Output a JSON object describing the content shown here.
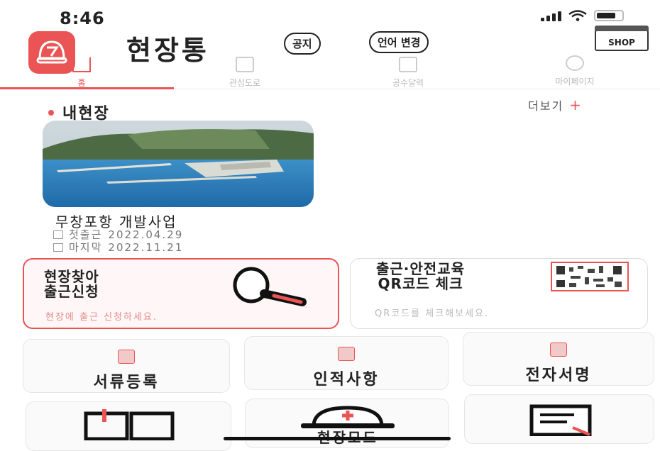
{
  "status": {
    "time": "8:46"
  },
  "header": {
    "title": "현장통",
    "notice_label": "공지",
    "lang_label": "언어 변경",
    "shop_label": "SHOP"
  },
  "tabs": [
    {
      "label": "홈",
      "icon": "home-icon",
      "active": true
    },
    {
      "label": "관심도로",
      "icon": "document-icon",
      "active": false
    },
    {
      "label": "공수달력",
      "icon": "calendar-icon",
      "active": false
    },
    {
      "label": "마이페이지",
      "icon": "user-icon",
      "active": false
    }
  ],
  "section": {
    "title": "내현장",
    "more_label": "더보기",
    "more_symbol": "+"
  },
  "site": {
    "name": "무창포항 개발사업",
    "first_label": "첫출근",
    "first_date": "2022.04.29",
    "last_label": "마지막",
    "last_date": "2022.11.21"
  },
  "cards": {
    "search": {
      "title_line1": "현장찾아",
      "title_line2": "출근신청",
      "subtitle": "현장에 출근 신청하세요."
    },
    "qr": {
      "title_line1": "출근·안전교육",
      "title_line2": "QR코드 체크",
      "subtitle": "QR코드를 체크해보세요."
    }
  },
  "tiles": [
    {
      "label": "서류등록",
      "icon": "upload-icon"
    },
    {
      "label": "인적사항",
      "icon": "person-card-icon"
    },
    {
      "label": "전자서명",
      "icon": "pen-icon"
    }
  ],
  "bottom_tiles": [
    {
      "label": "",
      "icon": "book-icon"
    },
    {
      "label": "현장모드",
      "icon": "helmet-icon"
    },
    {
      "label": "",
      "icon": "checklist-icon"
    }
  ],
  "colors": {
    "accent": "#ea5455"
  }
}
